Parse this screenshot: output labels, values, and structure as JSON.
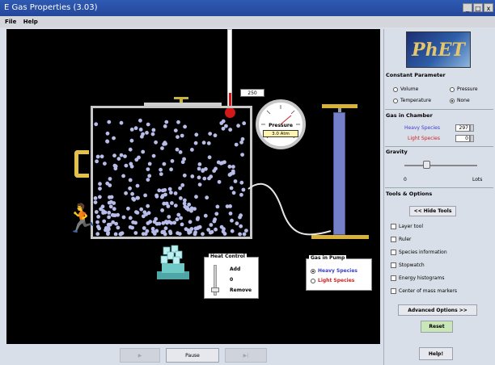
{
  "window": {
    "title": "E Gas Properties (3.03)",
    "controls": [
      "_",
      "□",
      "x"
    ]
  },
  "menu": {
    "items": [
      "File",
      "Help"
    ]
  },
  "simulation": {
    "thermometer_reading": "250",
    "pressure_gauge": {
      "label": "Pressure",
      "readout": "3.0 Atm"
    },
    "heat_control": {
      "title": "Heat Control",
      "add_label": "Add",
      "zero_label": "0",
      "remove_label": "Remove"
    },
    "gas_in_pump": {
      "title": "Gas in Pump",
      "options": [
        "Heavy Species",
        "Light Species"
      ],
      "selected": "Heavy Species"
    },
    "colors": {
      "heavy_species": "#b7bde8",
      "chamber_wall": "#c8c8c8",
      "pump": "#7680c8",
      "lid_hardware": "#d8b238"
    }
  },
  "playback": {
    "buttons": [
      "▶",
      "Pause",
      "▶|"
    ]
  },
  "panel": {
    "logo_text": "PhET",
    "constant_parameter": {
      "title": "Constant Parameter",
      "options": [
        "Volume",
        "Pressure",
        "Temperature",
        "None"
      ],
      "selected": "None"
    },
    "gas_in_chamber": {
      "title": "Gas in Chamber",
      "heavy_label": "Heavy Species",
      "heavy_value": "297",
      "light_label": "Light Species",
      "light_value": "0",
      "heavy_color": "#3b3bd0",
      "light_color": "#d02020"
    },
    "gravity": {
      "title": "Gravity",
      "min_label": "0",
      "max_label": "Lots",
      "level": 0.3
    },
    "tools": {
      "title": "Tools & Options",
      "hide_button": "<< Hide Tools",
      "checkboxes": [
        "Layer tool",
        "Ruler",
        "Species information",
        "Stopwatch",
        "Energy histograms",
        "Center of mass markers"
      ],
      "advanced_button": "Advanced Options >>",
      "reset_button": "Reset"
    },
    "help_button": "Help!"
  }
}
